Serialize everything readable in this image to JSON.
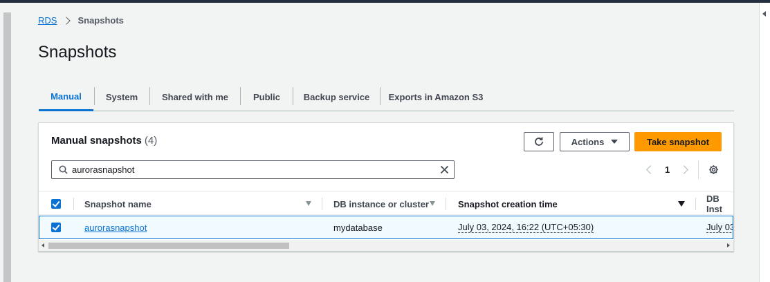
{
  "breadcrumb": {
    "root": "RDS",
    "current": "Snapshots"
  },
  "page": {
    "title": "Snapshots"
  },
  "tabs": [
    {
      "label": "Manual",
      "active": true
    },
    {
      "label": "System",
      "active": false
    },
    {
      "label": "Shared with me",
      "active": false
    },
    {
      "label": "Public",
      "active": false
    },
    {
      "label": "Backup service",
      "active": false
    },
    {
      "label": "Exports in Amazon S3",
      "active": false
    }
  ],
  "panel": {
    "title": "Manual snapshots",
    "count": "(4)",
    "actions_label": "Actions",
    "primary_label": "Take snapshot",
    "refresh_icon": "refresh-icon"
  },
  "search": {
    "value": "aurorasnapshot"
  },
  "pagination": {
    "current_page": "1"
  },
  "table": {
    "columns": [
      "Snapshot name",
      "DB instance or cluster",
      "Snapshot creation time",
      "DB Inst"
    ],
    "rows": [
      {
        "selected": true,
        "snapshot_name": "aurorasnapshot",
        "db_instance": "mydatabase",
        "creation_time": "July 03, 2024, 16:22 (UTC+05:30)",
        "db_inst_partial": "July 03"
      }
    ]
  },
  "colors": {
    "accent": "#0972d3",
    "primary_button": "#ff9900",
    "selected_row_bg": "#f1faff"
  }
}
